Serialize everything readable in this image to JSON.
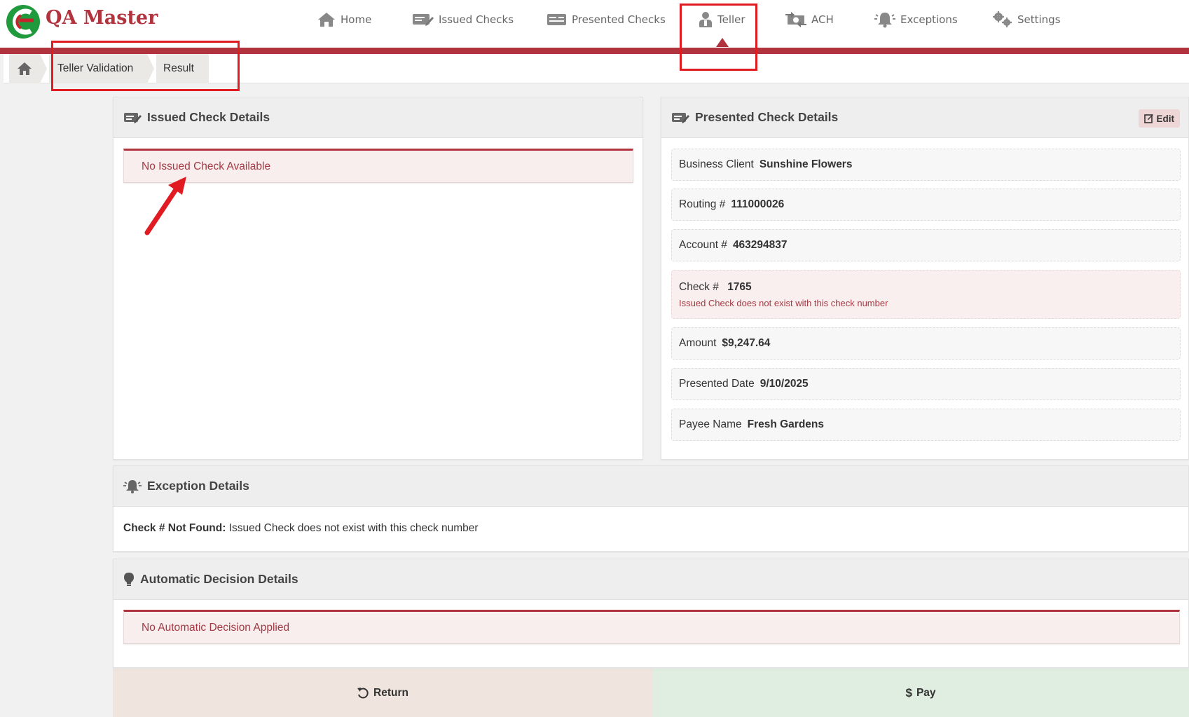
{
  "app": {
    "brand": "QA Master",
    "nav": [
      {
        "label": "Home",
        "icon": "home-icon"
      },
      {
        "label": "Issued Checks",
        "icon": "issued-checks-icon"
      },
      {
        "label": "Presented Checks",
        "icon": "presented-checks-icon"
      },
      {
        "label": "Teller",
        "icon": "teller-icon",
        "active": true
      },
      {
        "label": "ACH",
        "icon": "ach-icon"
      },
      {
        "label": "Exceptions",
        "icon": "bell-icon"
      },
      {
        "label": "Settings",
        "icon": "gears-icon"
      }
    ],
    "brand_color": "#b0333d"
  },
  "breadcrumb": {
    "items": [
      "Teller Validation",
      "Result"
    ]
  },
  "issued": {
    "title": "Issued Check Details",
    "message": "No Issued Check Available"
  },
  "presented": {
    "title": "Presented Check Details",
    "edit_label": "Edit",
    "rows": [
      {
        "label": "Business Client",
        "value": "Sunshine Flowers"
      },
      {
        "label": "Routing #",
        "value": "111000026"
      },
      {
        "label": "Account #",
        "value": "463294837"
      },
      {
        "label": "Check #",
        "value": "1765",
        "error": "Issued Check does not exist with this check number"
      },
      {
        "label": "Amount",
        "value": "$9,247.64"
      },
      {
        "label": "Presented Date",
        "value": "9/10/2025"
      },
      {
        "label": "Payee Name",
        "value": "Fresh Gardens"
      }
    ]
  },
  "exception": {
    "title": "Exception Details",
    "label": "Check # Not Found:",
    "text": "Issued Check does not exist with this check number"
  },
  "decision": {
    "title": "Automatic Decision Details",
    "message": "No Automatic Decision Applied"
  },
  "actions": {
    "return_label": "Return",
    "pay_label": "Pay"
  }
}
